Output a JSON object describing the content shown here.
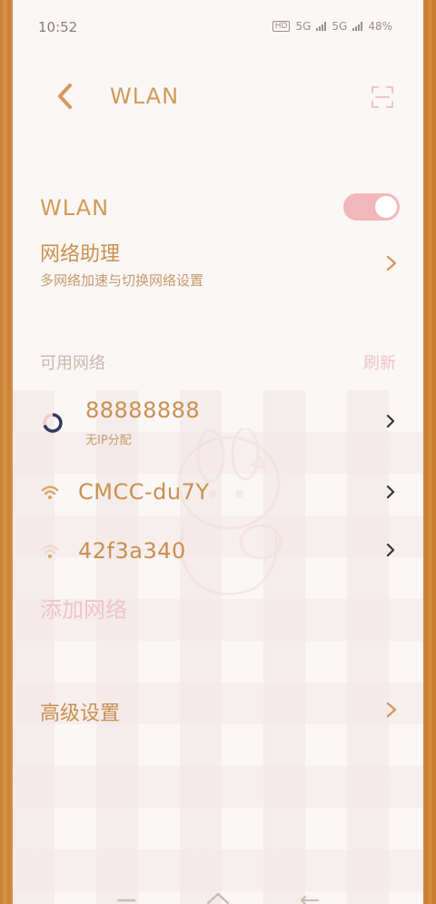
{
  "status": {
    "time": "10:52",
    "network1": "5G",
    "network2": "5G",
    "battery": "48%"
  },
  "header": {
    "title": "WLAN"
  },
  "wlan": {
    "label": "WLAN",
    "enabled": true
  },
  "assistant": {
    "title": "网络助理",
    "subtitle": "多网络加速与切换网络设置"
  },
  "available": {
    "label": "可用网络",
    "refresh": "刷新"
  },
  "networks": [
    {
      "name": "88888888",
      "status": "无IP分配",
      "icon": "connecting-ring-icon"
    },
    {
      "name": "CMCC-du7Y",
      "status": "",
      "icon": "wifi-icon"
    },
    {
      "name": "42f3a340",
      "status": "",
      "icon": "wifi-weak-icon"
    }
  ],
  "add_network": "添加网络",
  "advanced": "高级设置",
  "colors": {
    "accent": "#d29a58",
    "toggle": "#f1b7bb",
    "pink_text": "#f0c4c6"
  }
}
